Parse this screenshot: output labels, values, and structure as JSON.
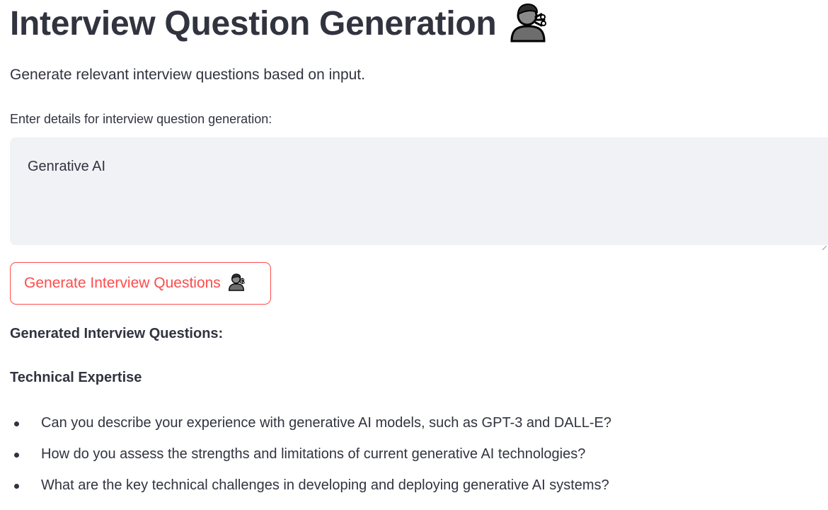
{
  "header": {
    "title": "Interview Question Generation",
    "title_icon": "person-blowing-kiss-emoji",
    "subtitle": "Generate relevant interview questions based on input."
  },
  "input": {
    "label": "Enter details for interview question generation:",
    "value": "Genrative AI"
  },
  "button": {
    "label": "Generate Interview Questions",
    "icon": "person-blowing-kiss-emoji",
    "color": "#ff4b4b"
  },
  "results": {
    "heading": "Generated Interview Questions:",
    "category": "Technical Expertise",
    "questions": [
      "Can you describe your experience with generative AI models, such as GPT-3 and DALL-E?",
      "How do you assess the strengths and limitations of current generative AI technologies?",
      "What are the key technical challenges in developing and deploying generative AI systems?"
    ]
  },
  "colors": {
    "text": "#31333f",
    "input_background": "#f0f2f6",
    "accent": "#ff4b4b"
  }
}
